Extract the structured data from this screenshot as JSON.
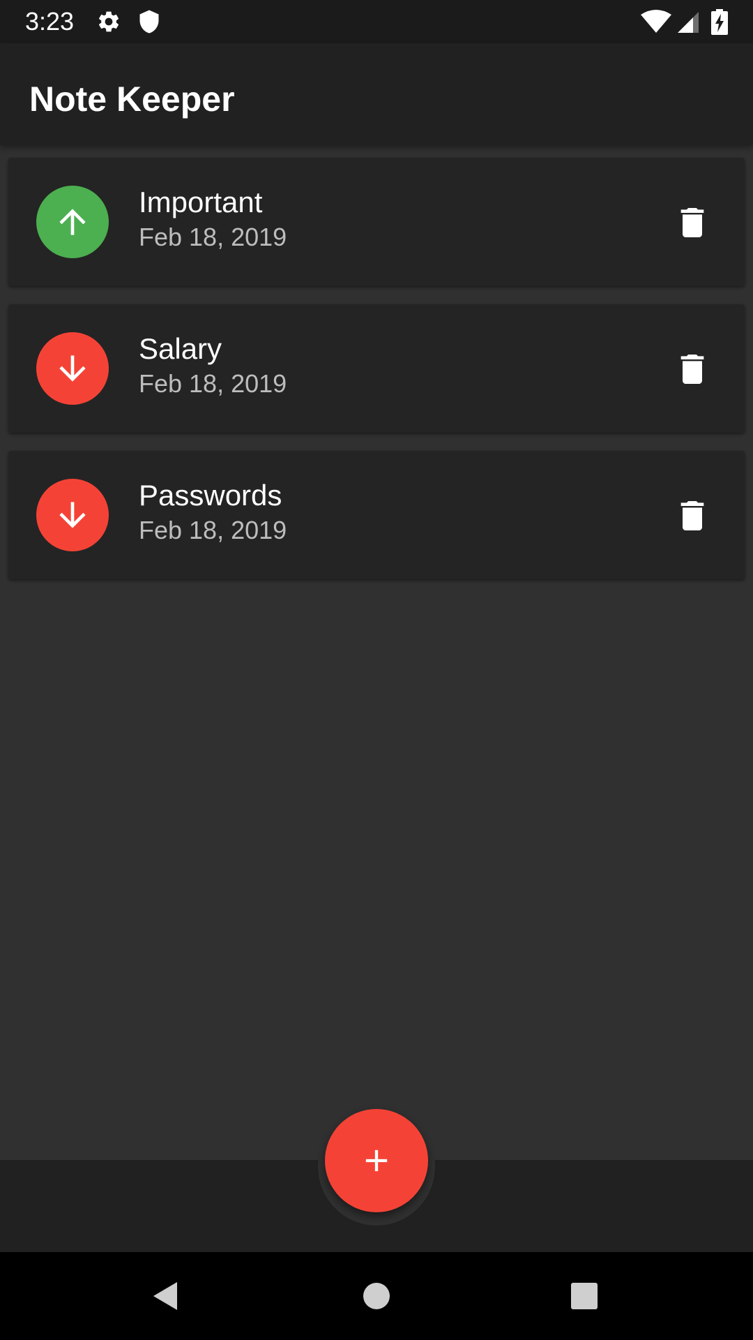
{
  "status_bar": {
    "time": "3:23",
    "left_icons": [
      "gear-icon",
      "shield-icon"
    ],
    "right_icons": [
      "wifi-icon",
      "signal-icon",
      "battery-charging-icon"
    ]
  },
  "app_bar": {
    "title": "Note Keeper"
  },
  "notes": [
    {
      "title": "Important",
      "date": "Feb 18, 2019",
      "priority": "high",
      "priority_icon": "arrow-up-icon",
      "priority_color": "#4caf50"
    },
    {
      "title": "Salary",
      "date": "Feb 18, 2019",
      "priority": "low",
      "priority_icon": "arrow-down-icon",
      "priority_color": "#f44336"
    },
    {
      "title": "Passwords",
      "date": "Feb 18, 2019",
      "priority": "low",
      "priority_icon": "arrow-down-icon",
      "priority_color": "#f44336"
    }
  ],
  "fab": {
    "icon": "plus-icon",
    "color": "#f44336"
  },
  "nav_bar": {
    "buttons": [
      "back-icon",
      "home-icon",
      "recents-icon"
    ]
  },
  "colors": {
    "background": "#303030",
    "app_bar": "#212121",
    "card": "#242424",
    "accent": "#f44336",
    "priority_high": "#4caf50",
    "priority_low": "#f44336"
  }
}
